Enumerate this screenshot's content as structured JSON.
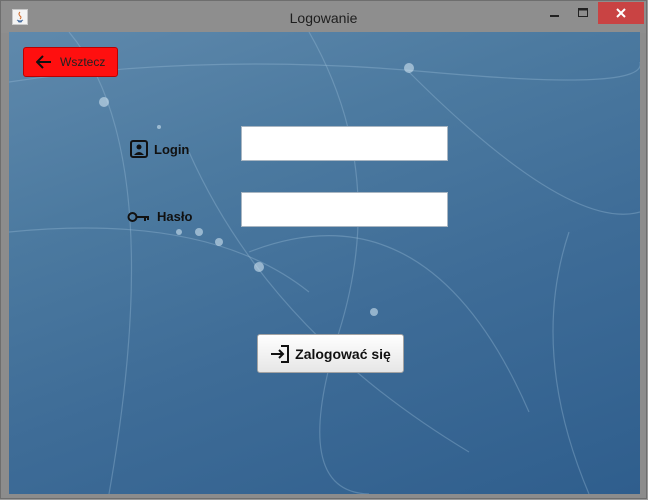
{
  "window": {
    "title": "Logowanie",
    "app_icon": "java-app-icon",
    "controls": [
      "minimize-icon",
      "maximize-icon",
      "close-icon"
    ],
    "close_color": "#c94343"
  },
  "back_button": {
    "label": "Wsztecz",
    "icon": "arrow-left-icon",
    "color": "#ff0f0f"
  },
  "form": {
    "login": {
      "label": "Login",
      "icon": "user-card-icon",
      "value": ""
    },
    "password": {
      "label": "Hasło",
      "icon": "key-icon",
      "value": ""
    }
  },
  "submit_button": {
    "label": "Zalogować się",
    "icon": "sign-in-icon"
  },
  "colors": {
    "background": "#3e6c97"
  }
}
